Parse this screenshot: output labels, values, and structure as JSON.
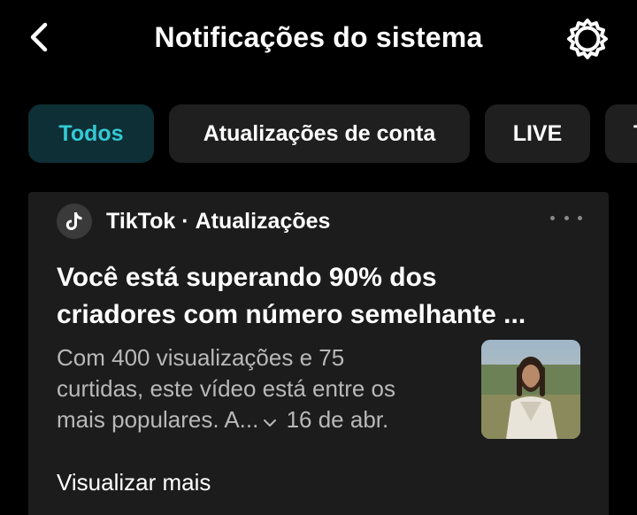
{
  "header": {
    "back_icon": "chevron-left-icon",
    "title": "Notificações do sistema",
    "settings_icon": "gear-icon"
  },
  "tabs": [
    {
      "label": "Todos",
      "active": true
    },
    {
      "label": "Atualizações de conta",
      "active": false
    },
    {
      "label": "LIVE",
      "active": false
    },
    {
      "label": "T",
      "active": false
    }
  ],
  "notification": {
    "source_name": "TikTok",
    "separator": "·",
    "source_category": "Atualizações",
    "source_icon": "tiktok-logo-icon",
    "more_icon": "more-horizontal-icon",
    "title_line1": "Você está superando 90% dos",
    "title_line2": "criadores com número semelhante ...",
    "body_line1": "Com 400 visualizações e 75",
    "body_line2": "curtidas, este vídeo está entre os",
    "body_line3": "mais populares. A...",
    "expand_icon": "chevron-down-icon",
    "date": "16 de abr.",
    "thumbnail": "video-thumbnail",
    "view_more": "Visualizar mais"
  },
  "colors": {
    "background": "#000000",
    "card": "#1c1c1c",
    "tab_inactive": "#1f1f1f",
    "tab_active_bg": "#0e2f35",
    "tab_active_text": "#33c9d4",
    "secondary_text": "#b8b8b8"
  }
}
